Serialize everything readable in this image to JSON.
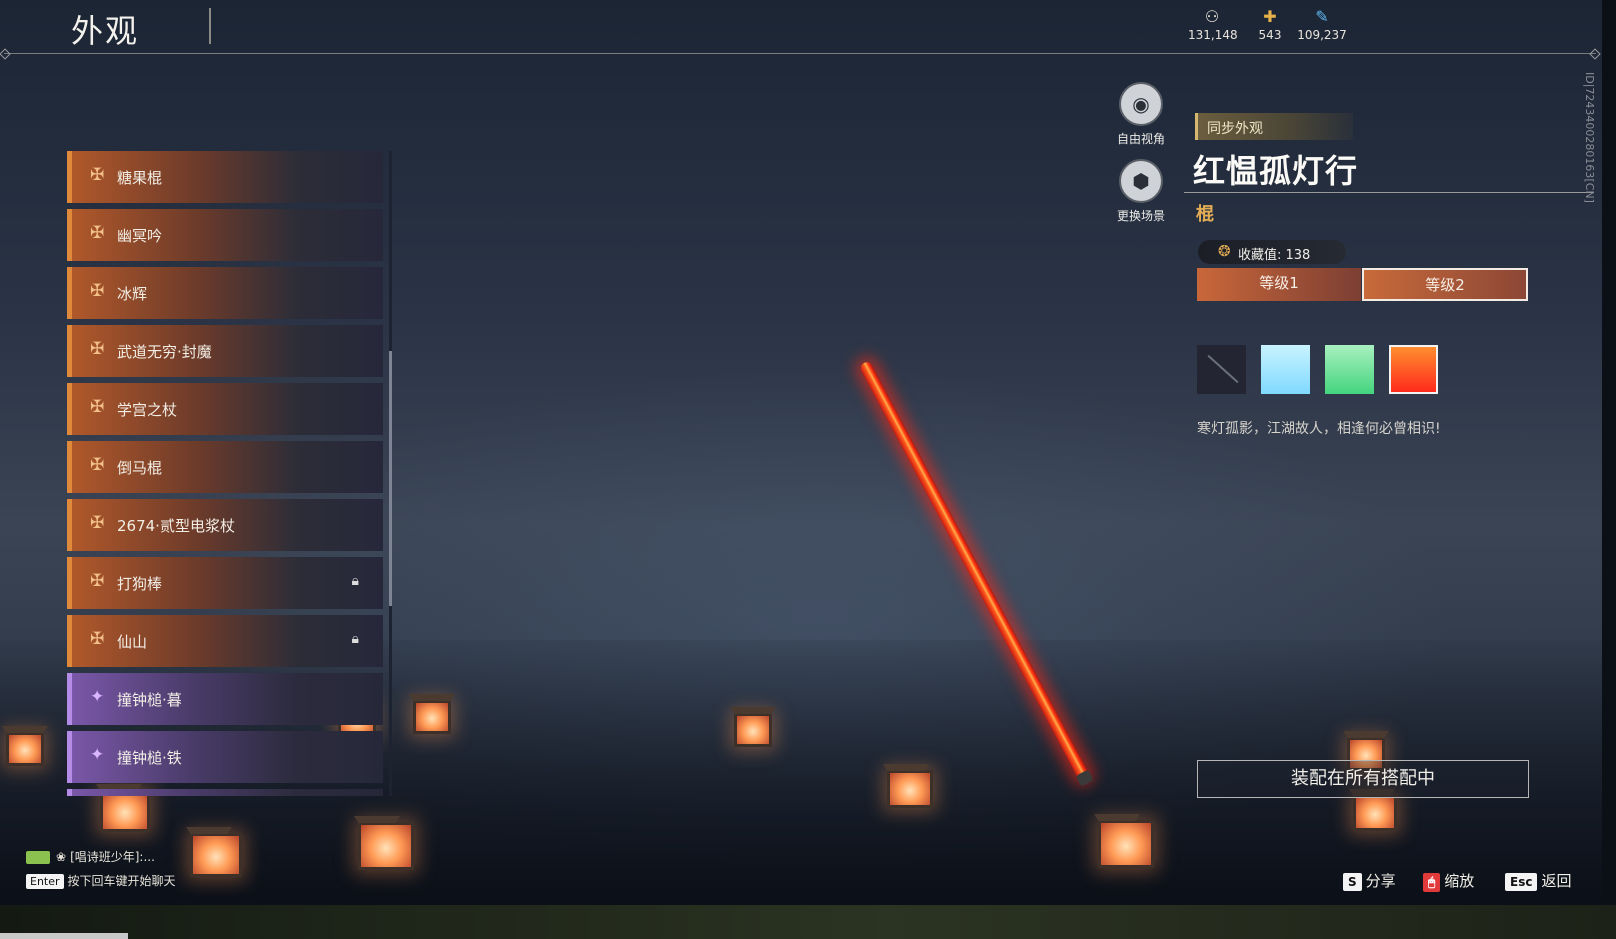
{
  "header": {
    "title": "外观"
  },
  "currencies": [
    {
      "icon": "coin-icon",
      "value": "131,148"
    },
    {
      "icon": "ticket-icon",
      "value": "543"
    },
    {
      "icon": "feather-icon",
      "value": "109,237"
    }
  ],
  "list": {
    "items": [
      {
        "label": "糖果棍",
        "rarity": "orange",
        "locked": false
      },
      {
        "label": "幽冥吟",
        "rarity": "orange",
        "locked": false
      },
      {
        "label": "冰辉",
        "rarity": "orange",
        "locked": false
      },
      {
        "label": "武道无穷·封魔",
        "rarity": "orange",
        "locked": false
      },
      {
        "label": "学宫之杖",
        "rarity": "orange",
        "locked": false
      },
      {
        "label": "倒马棍",
        "rarity": "orange",
        "locked": false
      },
      {
        "label": "2674·贰型电浆杖",
        "rarity": "orange",
        "locked": false
      },
      {
        "label": "打狗棒",
        "rarity": "orange",
        "locked": true
      },
      {
        "label": "仙山",
        "rarity": "orange",
        "locked": true
      },
      {
        "label": "撞钟槌·暮",
        "rarity": "purple",
        "locked": false
      },
      {
        "label": "撞钟槌·铁",
        "rarity": "purple",
        "locked": false
      }
    ]
  },
  "side_buttons": {
    "free_view": "自由视角",
    "change_scene": "更换场景"
  },
  "detail": {
    "sync_label": "同步外观",
    "name": "红愠孤灯行",
    "type": "棍",
    "collect_label": "收藏值: 138",
    "levels": [
      "等级1",
      "等级2"
    ],
    "selected_level_index": 1,
    "colors": [
      "#232632",
      "#a8e8ff",
      "#6fe39a",
      "#ff4a1e"
    ],
    "selected_color_index": 3,
    "description": "寒灯孤影，江湖故人，相逢何必曾相识!",
    "equip_label": "装配在所有搭配中"
  },
  "side_id": "ID|7243400280163[CN]",
  "chat": {
    "channel": "[唱诗班少年]:...",
    "enter_key": "Enter",
    "hint": "按下回车键开始聊天"
  },
  "actions": [
    {
      "key": "S",
      "label": "分享"
    },
    {
      "key": "🖱",
      "label": "缩放"
    },
    {
      "key": "Esc",
      "label": "返回"
    }
  ]
}
